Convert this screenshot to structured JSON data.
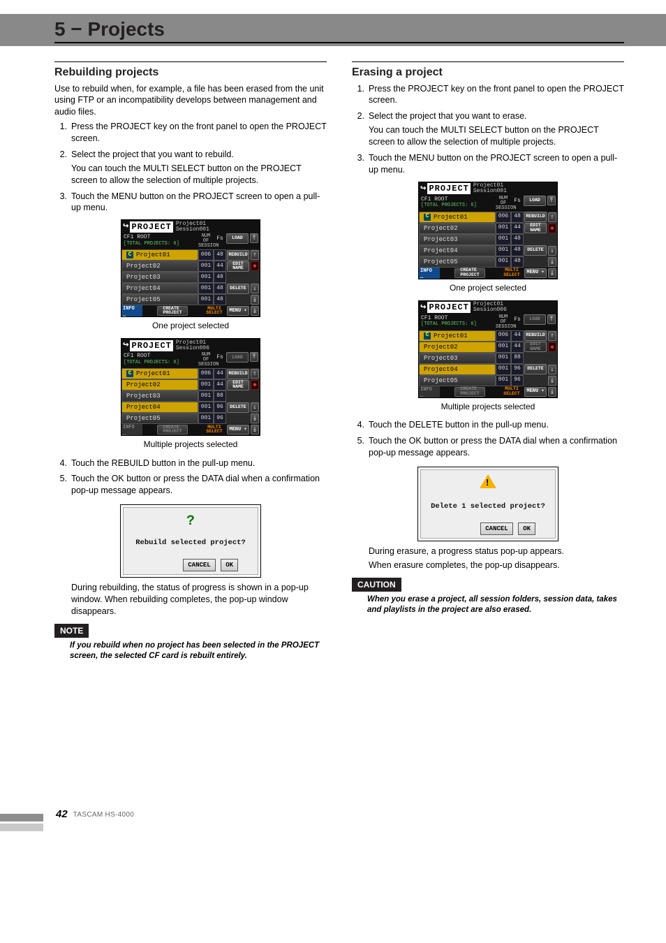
{
  "chapter": "5 − Projects",
  "page_footer": {
    "page_num": "42",
    "model": "TASCAM  HS-4000"
  },
  "left": {
    "heading": "Rebuilding projects",
    "intro": "Use to rebuild when, for example, a file has been erased from the unit using FTP or an incompatibility develops between management and audio files.",
    "steps": [
      {
        "n": "1.",
        "paras": [
          "Press the PROJECT key on the front panel to open the PROJECT screen."
        ]
      },
      {
        "n": "2.",
        "paras": [
          "Select the project that you want to rebuild.",
          "You can touch the MULTI SELECT button on the PROJECT screen to allow the selection of multiple projects."
        ]
      },
      {
        "n": "3.",
        "paras": [
          "Touch the MENU button on the PROJECT screen to open a pull-up menu."
        ]
      }
    ],
    "caption1": "One project selected",
    "caption2": "Multiple projects selected",
    "steps2": [
      {
        "n": "4.",
        "paras": [
          "Touch the REBUILD button in the pull-up menu."
        ]
      },
      {
        "n": "5.",
        "paras": [
          "Touch the OK button or press the DATA dial when a confirmation pop-up message appears."
        ]
      }
    ],
    "dialog": {
      "msg": "Rebuild selected project?",
      "cancel": "CANCEL",
      "ok": "OK"
    },
    "after_dialog": "During rebuilding, the status of progress is shown in a pop-up window. When rebuilding completes, the pop-up window disappears.",
    "note_label": "NOTE",
    "note_body": "If you rebuild when no project has been selected in the PROJECT screen, the selected CF card is rebuilt entirely."
  },
  "right": {
    "heading": "Erasing a project",
    "steps": [
      {
        "n": "1.",
        "paras": [
          "Press the PROJECT key on the front panel to open the PROJECT screen."
        ]
      },
      {
        "n": "2.",
        "paras": [
          "Select the project that you want to erase.",
          "You can touch the MULTI SELECT button on the PROJECT screen to allow the selection of multiple projects."
        ]
      },
      {
        "n": "3.",
        "paras": [
          "Touch the MENU button on the PROJECT screen to open a pull-up menu."
        ]
      }
    ],
    "caption1": "One project selected",
    "caption2": "Multiple projects selected",
    "steps2": [
      {
        "n": "4.",
        "paras": [
          "Touch the DELETE button in the pull-up menu."
        ]
      },
      {
        "n": "5.",
        "paras": [
          "Touch the OK button or press the DATA dial when a confirmation pop-up message appears."
        ]
      }
    ],
    "dialog": {
      "msg": "Delete 1 selected project?",
      "cancel": "CANCEL",
      "ok": "OK"
    },
    "after_dialog1": "During erasure, a progress status pop-up appears.",
    "after_dialog2": "When erasure completes, the pop-up disappears.",
    "caution_label": "CAUTION",
    "caution_body": "When you erase a project, all session folders, session data, takes and playlists in the project are also erased."
  },
  "proj": {
    "title_word": "PROJECT",
    "root_label": "CF1 ROOT",
    "total_pre": "[TOTAL PROJECTS:",
    "head_num": "NUM\nOF\nSESSION",
    "head_fs": "Fs",
    "foot_info": "INFO",
    "foot_create": "CREATE\nPROJECT",
    "foot_multi": "MULTI\nSELECT",
    "foot_menu": "MENU",
    "btn_load": "LOAD",
    "btn_rebuild": "REBUILD",
    "btn_edit": "EDIT\nNAME",
    "btn_delete": "DELETE",
    "scr1": {
      "sess": "Project01\nSession001",
      "total": "6]",
      "rows": [
        {
          "name": "Project01",
          "num": "006",
          "fs": "48",
          "sel": "c"
        },
        {
          "name": "Project02",
          "num": "001",
          "fs": "44",
          "sel": ""
        },
        {
          "name": "Project03",
          "num": "001",
          "fs": "48",
          "sel": ""
        },
        {
          "name": "Project04",
          "num": "001",
          "fs": "48",
          "sel": ""
        },
        {
          "name": "Project05",
          "num": "001",
          "fs": "48",
          "sel": ""
        }
      ]
    },
    "scr2": {
      "sess": "Project01\nSession006",
      "total": "6]",
      "rows": [
        {
          "name": "Project01",
          "num": "006",
          "fs": "44",
          "sel": "c"
        },
        {
          "name": "Project02",
          "num": "001",
          "fs": "44",
          "sel": "s"
        },
        {
          "name": "Project03",
          "num": "001",
          "fs": "88",
          "sel": ""
        },
        {
          "name": "Project04",
          "num": "001",
          "fs": "96",
          "sel": "s"
        },
        {
          "name": "Project05",
          "num": "001",
          "fs": "96",
          "sel": ""
        }
      ]
    },
    "scr3": {
      "sess": "Project01\nSession001",
      "total": "6]",
      "rows": [
        {
          "name": "Project01",
          "num": "006",
          "fs": "48",
          "sel": "c"
        },
        {
          "name": "Project02",
          "num": "001",
          "fs": "44",
          "sel": ""
        },
        {
          "name": "Project03",
          "num": "001",
          "fs": "48",
          "sel": ""
        },
        {
          "name": "Project04",
          "num": "001",
          "fs": "48",
          "sel": ""
        },
        {
          "name": "Project05",
          "num": "001",
          "fs": "48",
          "sel": ""
        }
      ]
    },
    "scr4": {
      "sess": "Project01\nSession006",
      "total": "6]",
      "rows": [
        {
          "name": "Project01",
          "num": "006",
          "fs": "44",
          "sel": "c"
        },
        {
          "name": "Project02",
          "num": "001",
          "fs": "44",
          "sel": "s"
        },
        {
          "name": "Project03",
          "num": "001",
          "fs": "88",
          "sel": ""
        },
        {
          "name": "Project04",
          "num": "001",
          "fs": "96",
          "sel": "s"
        },
        {
          "name": "Project05",
          "num": "001",
          "fs": "96",
          "sel": ""
        }
      ]
    }
  }
}
